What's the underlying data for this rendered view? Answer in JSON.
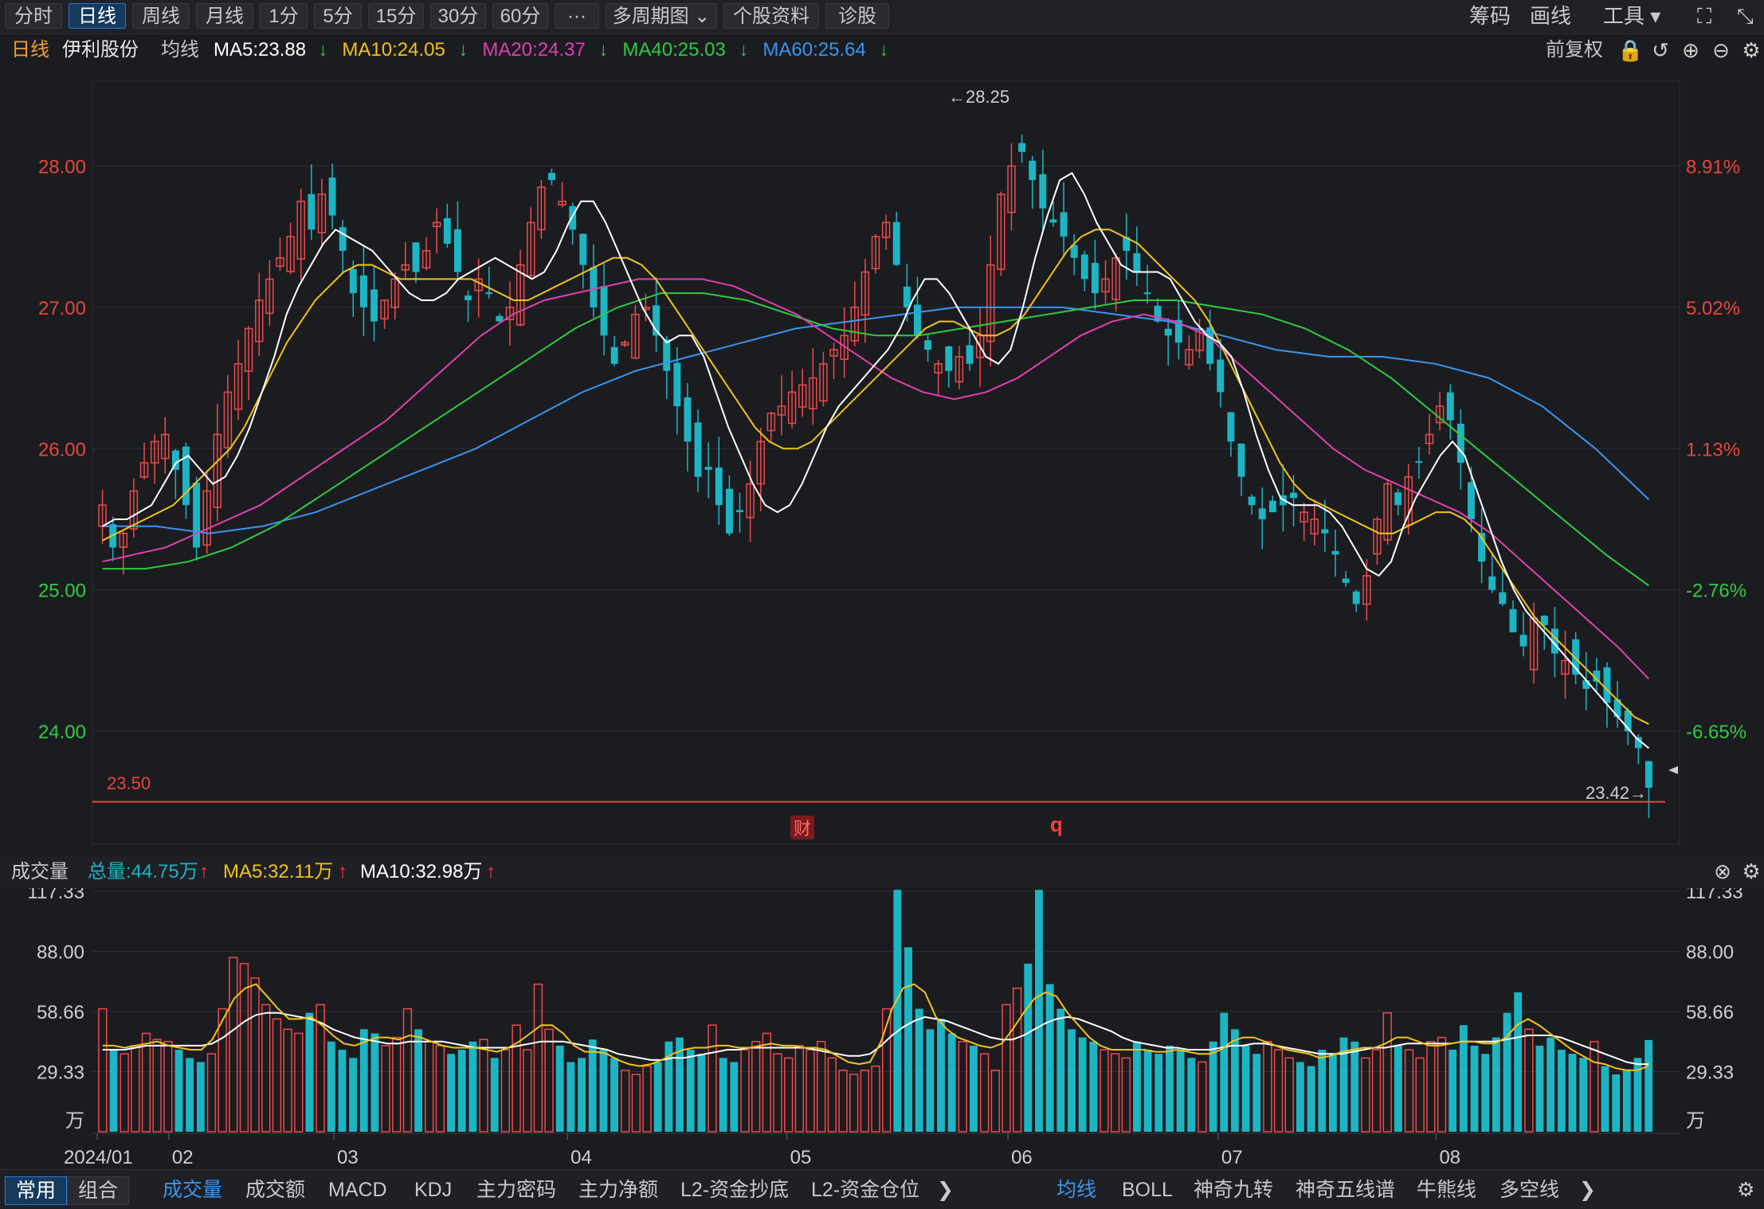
{
  "toolbar": {
    "tabs": [
      "分时",
      "日线",
      "周线",
      "月线",
      "1分",
      "5分",
      "15分",
      "30分",
      "60分",
      "···",
      "多周期图",
      "个股资料",
      "诊股"
    ],
    "active_tab": "日线",
    "right": [
      "筹码",
      "画线",
      "工具"
    ]
  },
  "header": {
    "period": "日线",
    "stock_name": "伊利股份",
    "ma_label": "均线",
    "ma": [
      {
        "text": "MA5:23.88",
        "color": "#ffffff"
      },
      {
        "text": "MA10:24.05",
        "color": "#f2c318"
      },
      {
        "text": "MA20:24.37",
        "color": "#e040b0"
      },
      {
        "text": "MA40:25.03",
        "color": "#2ecc40"
      },
      {
        "text": "MA60:25.64",
        "color": "#3a95f0"
      }
    ],
    "adjust": "前复权"
  },
  "volume_header": {
    "title": "成交量",
    "total": "总量:44.75万",
    "ma5": "MA5:32.11万",
    "ma10": "MA10:32.98万"
  },
  "bottom": {
    "groups": [
      "常用",
      "组合"
    ],
    "indicators": [
      "成交量",
      "成交额",
      "MACD",
      "KDJ",
      "主力密码",
      "主力净额",
      "L2-资金抄底",
      "L2-资金仓位"
    ],
    "overlays": [
      "均线",
      "BOLL",
      "神奇九转",
      "神奇五线谱",
      "牛熊线",
      "多空线"
    ]
  },
  "chart_data": [
    {
      "type": "candlestick",
      "title": "伊利股份 日线",
      "y_ticks": [
        "28.00",
        "27.00",
        "26.00",
        "25.00",
        "24.00"
      ],
      "y_ticks_right": [
        "8.91%",
        "5.02%",
        "1.13%",
        "-2.76%",
        "-6.65%"
      ],
      "ylim": [
        23.2,
        28.6
      ],
      "x_labels": [
        "2024/01",
        "02",
        "03",
        "04",
        "05",
        "06",
        "07",
        "08"
      ],
      "annotations": {
        "high_label": "←28.25",
        "low_label": "23.42→",
        "level_line": "23.50",
        "marker_cai": "财",
        "marker_q": "q"
      },
      "closes": [
        25.6,
        25.3,
        25.4,
        25.7,
        25.9,
        26.05,
        26.1,
        25.85,
        25.6,
        25.3,
        25.7,
        26.1,
        26.4,
        26.6,
        26.85,
        27.05,
        27.2,
        27.35,
        27.5,
        27.75,
        27.55,
        27.8,
        27.65,
        27.4,
        27.1,
        27.0,
        26.9,
        27.05,
        27.2,
        27.3,
        27.25,
        27.4,
        27.6,
        27.45,
        27.25,
        27.05,
        27.2,
        27.1,
        26.9,
        27.0,
        27.3,
        27.6,
        27.85,
        27.9,
        27.75,
        27.55,
        27.3,
        27.0,
        26.8,
        26.6,
        26.75,
        26.95,
        27.0,
        26.8,
        26.55,
        26.3,
        26.05,
        25.8,
        25.85,
        25.6,
        25.4,
        25.55,
        25.75,
        26.05,
        26.25,
        26.3,
        26.4,
        26.45,
        26.5,
        26.6,
        26.7,
        26.8,
        27.0,
        27.25,
        27.5,
        27.6,
        27.3,
        27.0,
        26.8,
        26.7,
        26.6,
        26.55,
        26.65,
        26.6,
        26.8,
        27.3,
        27.8,
        28.0,
        28.1,
        27.9,
        27.7,
        27.6,
        27.5,
        27.35,
        27.2,
        27.1,
        27.2,
        27.35,
        27.4,
        27.25,
        27.1,
        26.9,
        26.8,
        26.75,
        26.7,
        26.85,
        26.6,
        26.4,
        26.05,
        25.8,
        25.6,
        25.5,
        25.55,
        25.6,
        25.65,
        25.55,
        25.5,
        25.4,
        25.25,
        25.05,
        24.9,
        25.1,
        25.5,
        25.75,
        25.6,
        25.8,
        25.9,
        26.1,
        26.3,
        26.2,
        25.9,
        25.5,
        25.2,
        25.0,
        24.9,
        24.7,
        24.6,
        24.8,
        24.75,
        24.55,
        24.5,
        24.4,
        24.3,
        24.35,
        24.2,
        24.1,
        24.0,
        23.88,
        23.6
      ],
      "ma5": [
        25.45,
        25.5,
        25.5,
        25.55,
        25.6,
        25.75,
        25.9,
        25.95,
        25.85,
        25.75,
        25.8,
        25.95,
        26.15,
        26.4,
        26.65,
        26.95,
        27.15,
        27.3,
        27.45,
        27.55,
        27.5,
        27.45,
        27.4,
        27.3,
        27.2,
        27.1,
        27.05,
        27.05,
        27.1,
        27.2,
        27.25,
        27.3,
        27.35,
        27.3,
        27.25,
        27.2,
        27.25,
        27.4,
        27.6,
        27.75,
        27.75,
        27.6,
        27.4,
        27.2,
        27.0,
        26.85,
        26.75,
        26.8,
        26.8,
        26.65,
        26.4,
        26.15,
        25.95,
        25.75,
        25.6,
        25.55,
        25.6,
        25.75,
        25.95,
        26.15,
        26.3,
        26.4,
        26.5,
        26.6,
        26.7,
        26.85,
        27.05,
        27.2,
        27.2,
        27.1,
        26.95,
        26.8,
        26.65,
        26.6,
        26.7,
        27.0,
        27.35,
        27.65,
        27.9,
        27.95,
        27.8,
        27.6,
        27.45,
        27.3,
        27.25,
        27.25,
        27.25,
        27.2,
        27.05,
        26.9,
        26.8,
        26.75,
        26.65,
        26.4,
        26.1,
        25.85,
        25.65,
        25.6,
        25.6,
        25.6,
        25.55,
        25.45,
        25.3,
        25.15,
        25.1,
        25.2,
        25.45,
        25.65,
        25.8,
        25.95,
        26.05,
        25.95,
        25.7,
        25.45,
        25.2,
        25.0,
        24.85,
        24.75,
        24.65,
        24.55,
        24.45,
        24.35,
        24.25,
        24.15,
        24.05,
        23.95,
        23.88
      ],
      "ma10": [
        25.35,
        25.4,
        25.45,
        25.5,
        25.55,
        25.6,
        25.7,
        25.8,
        25.9,
        26.0,
        26.15,
        26.35,
        26.55,
        26.75,
        26.9,
        27.05,
        27.15,
        27.25,
        27.3,
        27.3,
        27.25,
        27.2,
        27.2,
        27.2,
        27.2,
        27.2,
        27.2,
        27.15,
        27.1,
        27.05,
        27.05,
        27.1,
        27.15,
        27.2,
        27.25,
        27.3,
        27.35,
        27.35,
        27.3,
        27.2,
        27.05,
        26.9,
        26.75,
        26.6,
        26.45,
        26.3,
        26.15,
        26.05,
        26.0,
        26.0,
        26.05,
        26.15,
        26.25,
        26.35,
        26.45,
        26.55,
        26.65,
        26.75,
        26.85,
        26.9,
        26.9,
        26.85,
        26.8,
        26.8,
        26.85,
        26.95,
        27.1,
        27.25,
        27.4,
        27.5,
        27.55,
        27.55,
        27.5,
        27.45,
        27.35,
        27.25,
        27.15,
        27.05,
        26.9,
        26.7,
        26.5,
        26.3,
        26.1,
        25.9,
        25.75,
        25.65,
        25.6,
        25.55,
        25.5,
        25.45,
        25.4,
        25.4,
        25.45,
        25.5,
        25.55,
        25.55,
        25.5,
        25.4,
        25.25,
        25.1,
        24.95,
        24.8,
        24.7,
        24.6,
        24.5,
        24.4,
        24.3,
        24.2,
        24.1,
        24.05
      ],
      "ma20": [
        25.2,
        25.25,
        25.3,
        25.4,
        25.5,
        25.6,
        25.75,
        25.9,
        26.05,
        26.2,
        26.4,
        26.6,
        26.8,
        26.95,
        27.05,
        27.1,
        27.15,
        27.2,
        27.2,
        27.2,
        27.15,
        27.05,
        26.95,
        26.8,
        26.65,
        26.5,
        26.4,
        26.35,
        26.4,
        26.5,
        26.65,
        26.8,
        26.9,
        26.95,
        26.9,
        26.8,
        26.6,
        26.4,
        26.2,
        26.0,
        25.85,
        25.75,
        25.65,
        25.55,
        25.4,
        25.2,
        25.0,
        24.8,
        24.6,
        24.37
      ],
      "ma40": [
        25.15,
        25.15,
        25.2,
        25.3,
        25.45,
        25.65,
        25.85,
        26.05,
        26.25,
        26.45,
        26.65,
        26.85,
        27.0,
        27.1,
        27.1,
        27.05,
        26.95,
        26.85,
        26.8,
        26.8,
        26.85,
        26.9,
        26.95,
        27.0,
        27.05,
        27.05,
        27.0,
        26.95,
        26.85,
        26.7,
        26.5,
        26.25,
        26.0,
        25.75,
        25.5,
        25.25,
        25.03
      ],
      "ma60": [
        25.45,
        25.45,
        25.4,
        25.45,
        25.55,
        25.7,
        25.85,
        26.0,
        26.2,
        26.4,
        26.55,
        26.65,
        26.75,
        26.85,
        26.9,
        26.95,
        27.0,
        27.0,
        27.0,
        26.95,
        26.9,
        26.8,
        26.7,
        26.65,
        26.65,
        26.6,
        26.5,
        26.3,
        26.0,
        25.64
      ]
    },
    {
      "type": "bar",
      "title": "成交量",
      "y_ticks": [
        "117.33",
        "88.00",
        "58.66",
        "29.33"
      ],
      "unit": "万",
      "ylim": [
        0,
        117.33
      ],
      "values": [
        60,
        40,
        38,
        42,
        48,
        45,
        44,
        40,
        36,
        34,
        38,
        60,
        85,
        82,
        75,
        62,
        55,
        50,
        48,
        58,
        62,
        44,
        40,
        36,
        50,
        48,
        42,
        46,
        60,
        50,
        44,
        42,
        38,
        40,
        44,
        45,
        36,
        40,
        52,
        40,
        72,
        50,
        42,
        34,
        36,
        45,
        40,
        36,
        30,
        28,
        32,
        34,
        44,
        46,
        40,
        38,
        52,
        36,
        34,
        40,
        44,
        48,
        38,
        36,
        42,
        40,
        44,
        36,
        30,
        28,
        30,
        32,
        60,
        118,
        90,
        60,
        50,
        55,
        48,
        44,
        42,
        38,
        30,
        62,
        70,
        82,
        118,
        72,
        60,
        50,
        46,
        44,
        40,
        38,
        36,
        44,
        40,
        38,
        42,
        40,
        36,
        34,
        44,
        58,
        50,
        42,
        38,
        44,
        40,
        36,
        34,
        32,
        40,
        38,
        46,
        44,
        36,
        40,
        58,
        42,
        40,
        36,
        44,
        46,
        40,
        52,
        42,
        38,
        46,
        58,
        68,
        50,
        42,
        46,
        40,
        38,
        36,
        44,
        32,
        28,
        30,
        36,
        44.75
      ],
      "ma5": [
        42,
        42,
        41,
        42,
        43,
        44,
        42,
        41,
        40,
        40,
        45,
        55,
        65,
        70,
        72,
        66,
        60,
        55,
        55,
        56,
        52,
        47,
        43,
        42,
        44,
        46,
        46,
        45,
        47,
        46,
        44,
        42,
        41,
        41,
        41,
        40,
        39,
        41,
        44,
        48,
        52,
        52,
        48,
        42,
        39,
        39,
        38,
        35,
        33,
        32,
        33,
        35,
        38,
        40,
        41,
        41,
        42,
        42,
        41,
        41,
        42,
        43,
        42,
        42,
        41,
        41,
        40,
        37,
        34,
        33,
        34,
        44,
        60,
        70,
        72,
        68,
        56,
        50,
        46,
        44,
        42,
        41,
        43,
        50,
        58,
        65,
        68,
        66,
        58,
        52,
        46,
        42,
        40,
        40,
        40,
        40,
        39,
        39,
        40,
        39,
        38,
        38,
        40,
        44,
        46,
        46,
        44,
        42,
        40,
        39,
        38,
        36,
        37,
        39,
        40,
        41,
        41,
        43,
        46,
        46,
        44,
        42,
        42,
        43,
        44,
        44,
        43,
        43,
        46,
        52,
        55,
        52,
        48,
        44,
        40,
        37,
        34,
        33,
        31,
        30,
        30,
        32.11
      ],
      "ma10": [
        40,
        40,
        40,
        41,
        42,
        42,
        42,
        42,
        42,
        42,
        43,
        46,
        50,
        54,
        57,
        58,
        58,
        57,
        56,
        55,
        53,
        50,
        48,
        46,
        45,
        44,
        43,
        43,
        44,
        44,
        44,
        44,
        43,
        42,
        41,
        41,
        41,
        41,
        42,
        43,
        44,
        44,
        44,
        43,
        42,
        41,
        40,
        38,
        37,
        36,
        35,
        35,
        36,
        36,
        37,
        38,
        39,
        40,
        40,
        41,
        41,
        41,
        41,
        41,
        41,
        40,
        39,
        38,
        37,
        37,
        38,
        42,
        47,
        51,
        54,
        56,
        55,
        54,
        52,
        50,
        48,
        46,
        45,
        45,
        47,
        50,
        53,
        55,
        56,
        55,
        53,
        51,
        49,
        46,
        44,
        43,
        42,
        41,
        41,
        40,
        40,
        40,
        41,
        42,
        42,
        43,
        43,
        42,
        41,
        40,
        39,
        38,
        38,
        38,
        39,
        40,
        41,
        41,
        42,
        43,
        43,
        43,
        43,
        43,
        44,
        44,
        44,
        44,
        45,
        46,
        47,
        47,
        47,
        46,
        44,
        42,
        40,
        38,
        36,
        34,
        33,
        32.98
      ]
    }
  ]
}
